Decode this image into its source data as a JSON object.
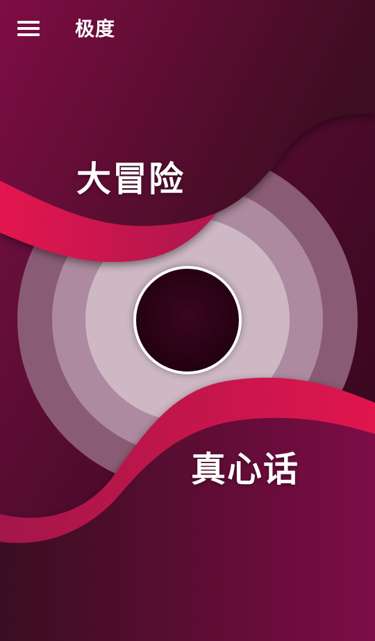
{
  "app": {
    "title": "极度"
  },
  "options": {
    "dare": "大冒险",
    "truth": "真心话"
  },
  "colors": {
    "background_dark": "#3a0a22",
    "background_mid": "#6e0f40",
    "wave_accent": "#d8134e",
    "ring_outer": "#8a5b74",
    "ring_middle": "#ad8a9f",
    "ring_inner": "#cdb8c4",
    "center_fill": "#22010f",
    "text": "#ffffff"
  },
  "icons": {
    "menu": "hamburger-menu-icon"
  }
}
